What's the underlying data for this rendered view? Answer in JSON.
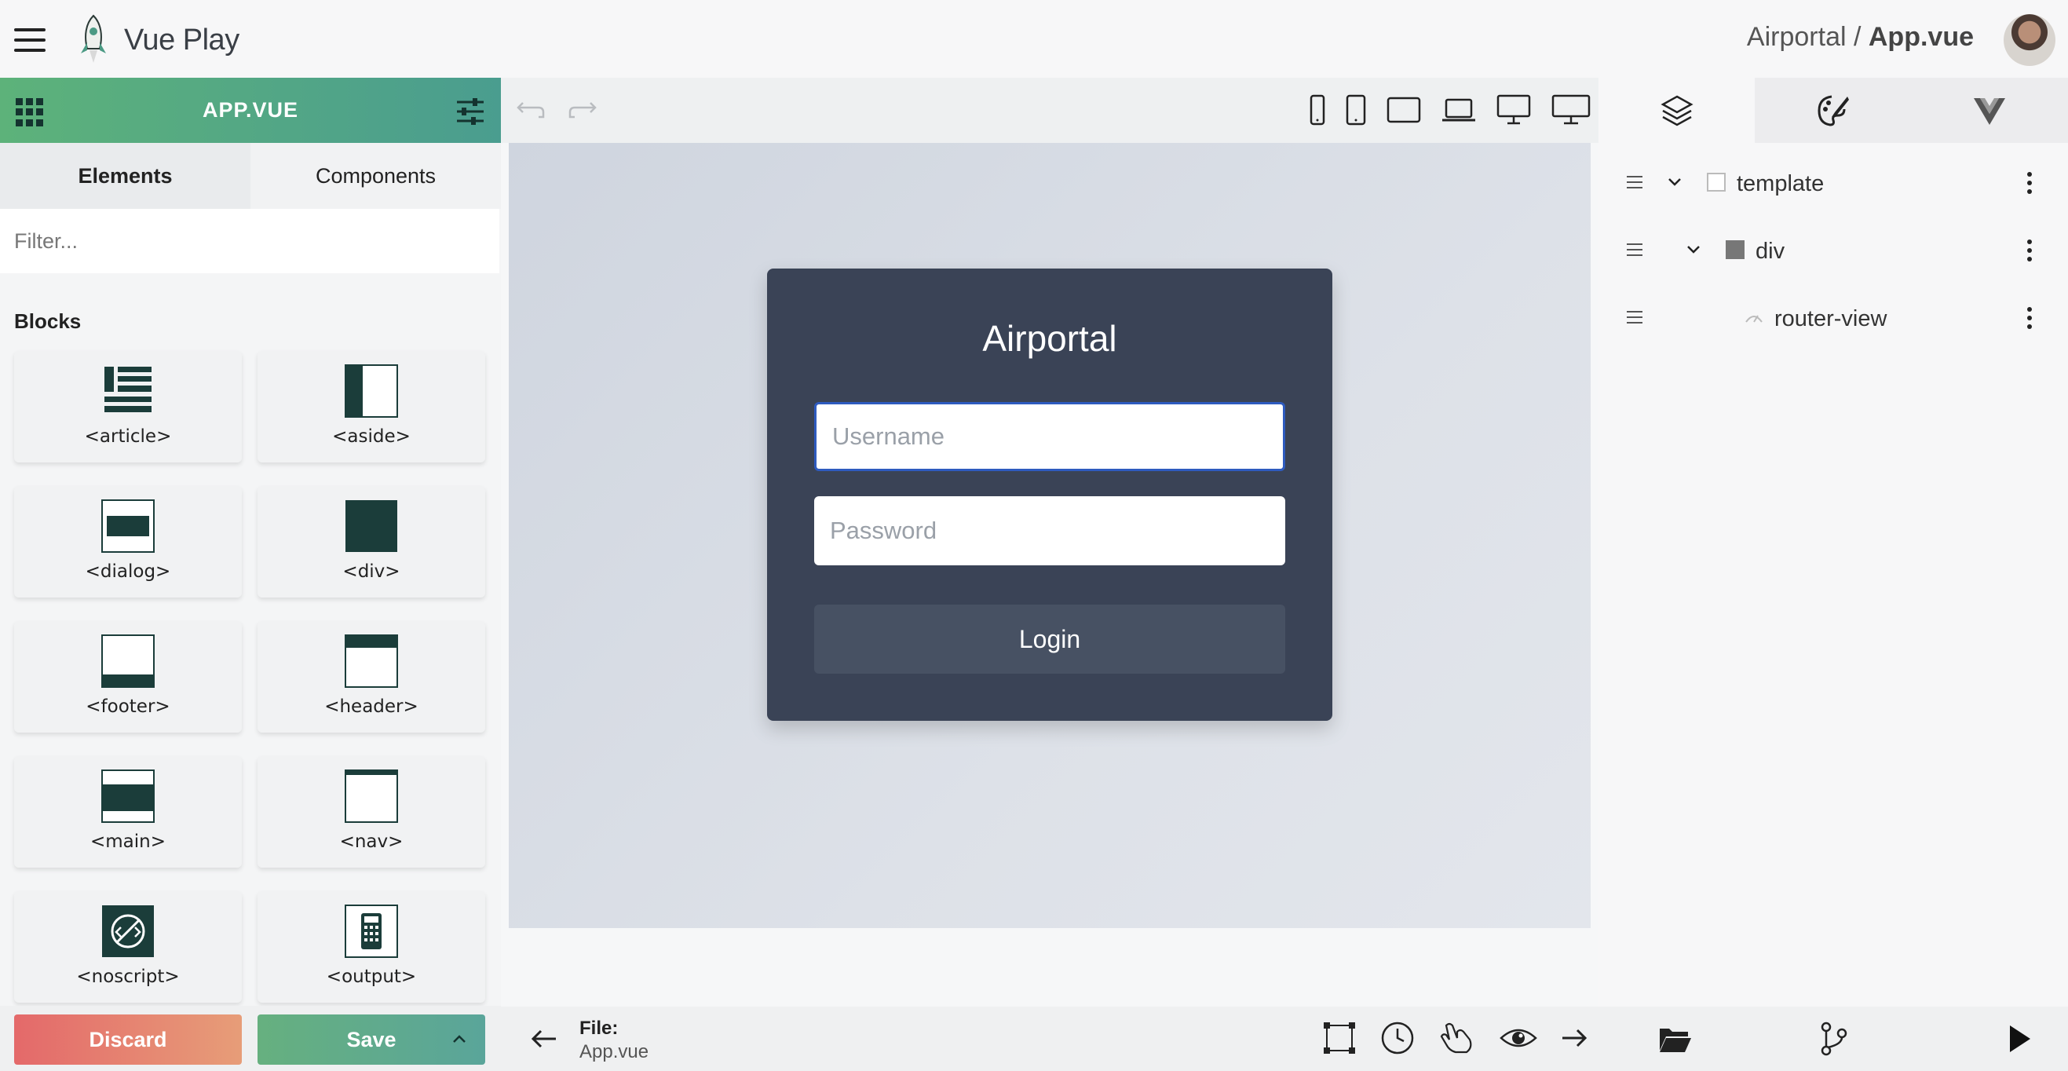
{
  "app": {
    "logo_name": "Vue",
    "logo_suffix": "Play",
    "breadcrumb_project": "Airportal",
    "breadcrumb_sep": " / ",
    "breadcrumb_file": "App.vue"
  },
  "left_panel": {
    "title": "APP.VUE",
    "tabs": [
      {
        "label": "Elements",
        "active": true
      },
      {
        "label": "Components",
        "active": false
      }
    ],
    "filter_placeholder": "Filter...",
    "section_label": "Blocks",
    "blocks": [
      {
        "label": "<article>",
        "icon": "article-icon"
      },
      {
        "label": "<aside>",
        "icon": "aside-icon"
      },
      {
        "label": "<dialog>",
        "icon": "dialog-icon"
      },
      {
        "label": "<div>",
        "icon": "div-icon"
      },
      {
        "label": "<footer>",
        "icon": "footer-icon"
      },
      {
        "label": "<header>",
        "icon": "header-icon"
      },
      {
        "label": "<main>",
        "icon": "main-icon"
      },
      {
        "label": "<nav>",
        "icon": "nav-icon"
      },
      {
        "label": "<noscript>",
        "icon": "noscript-icon"
      },
      {
        "label": "<output>",
        "icon": "output-icon"
      }
    ],
    "discard_label": "Discard",
    "save_label": "Save"
  },
  "canvas": {
    "card_title": "Airportal",
    "username_placeholder": "Username",
    "password_placeholder": "Password",
    "login_label": "Login"
  },
  "bottom_bar": {
    "file_label": "File:",
    "file_name": "App.vue"
  },
  "right_panel": {
    "tree": [
      {
        "label": "template",
        "depth": 0,
        "expanded": true
      },
      {
        "label": "div",
        "depth": 1,
        "expanded": true
      },
      {
        "label": "router-view",
        "depth": 2
      }
    ]
  },
  "colors": {
    "brand_green": "#5db27a",
    "accent_teal": "#4a9d8f",
    "discard_red": "#e4696a",
    "card_bg": "#3a4356",
    "focus_blue": "#2e5bbf",
    "block_icon": "#1b3d3a"
  }
}
